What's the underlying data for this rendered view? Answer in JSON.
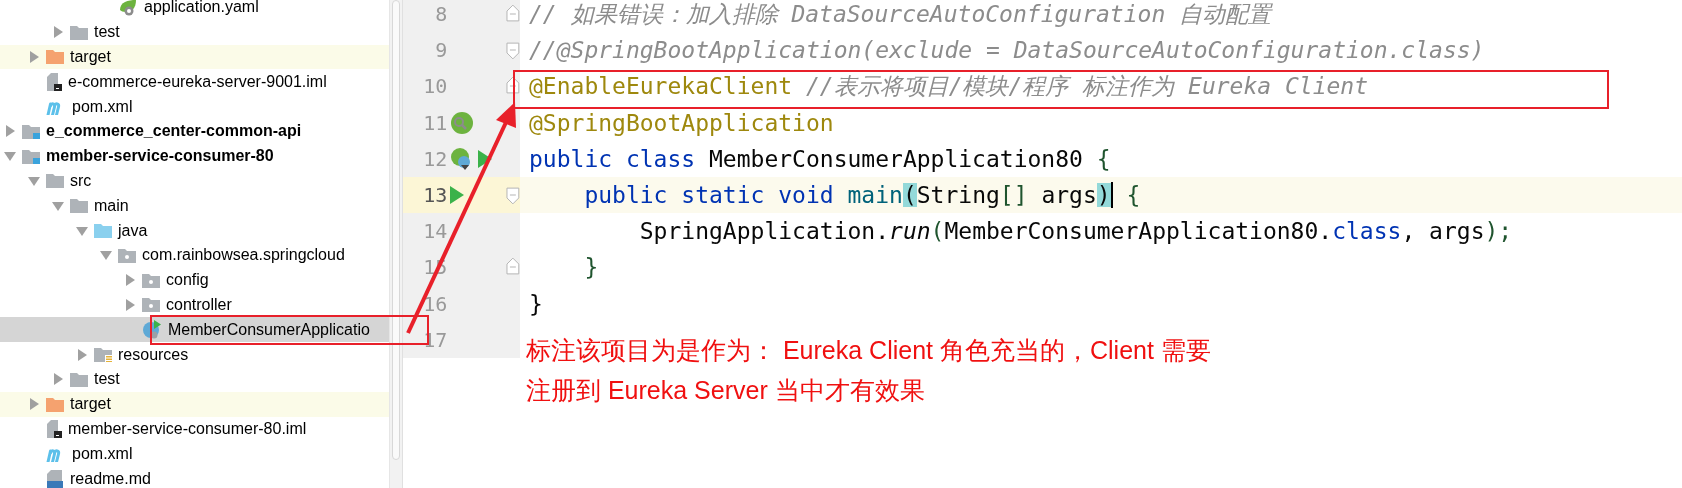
{
  "project_tree": {
    "items": [
      {
        "children": [
          {
            "children": [
              {
                "children": [
                  {
                    "children": [
                      {
                        "label": "application.yaml",
                        "kind": "yaml",
                        "selected": false
                      }
                    ]
                  }
                ]
              },
              {
                "label": "test",
                "kind": "folder",
                "expanded": false,
                "selected": false
              }
            ]
          },
          {
            "label": "target",
            "kind": "excluded-folder",
            "expanded": false,
            "selected": false
          },
          {
            "label": "e-commerce-eureka-server-9001.iml",
            "kind": "iml",
            "selected": false
          },
          {
            "label": "pom.xml",
            "kind": "pom",
            "selected": false
          }
        ]
      },
      {
        "label": "e_commerce_center-common-api",
        "kind": "module",
        "expanded": false,
        "selected": false
      },
      {
        "label": "member-service-consumer-80",
        "kind": "module",
        "expanded": true,
        "selected": false,
        "children": [
          {
            "label": "src",
            "kind": "folder",
            "expanded": true,
            "selected": false,
            "children": [
              {
                "label": "main",
                "kind": "folder",
                "expanded": true,
                "selected": false,
                "children": [
                  {
                    "label": "java",
                    "kind": "source-folder",
                    "expanded": true,
                    "selected": false,
                    "children": [
                      {
                        "label": "com.rainbowsea.springcloud",
                        "kind": "package",
                        "expanded": true,
                        "selected": false,
                        "children": [
                          {
                            "label": "config",
                            "kind": "package",
                            "expanded": false,
                            "selected": false
                          },
                          {
                            "label": "controller",
                            "kind": "package",
                            "expanded": false,
                            "selected": false
                          },
                          {
                            "label": "MemberConsumerApplicatio",
                            "kind": "class",
                            "selected": true
                          }
                        ]
                      }
                    ]
                  },
                  {
                    "label": "resources",
                    "kind": "resources",
                    "expanded": false,
                    "selected": false
                  }
                ]
              },
              {
                "label": "test",
                "kind": "folder",
                "expanded": false,
                "selected": false
              }
            ]
          },
          {
            "label": "target",
            "kind": "excluded-folder",
            "expanded": false,
            "selected": false
          },
          {
            "label": "member-service-consumer-80.iml",
            "kind": "iml",
            "selected": false
          },
          {
            "label": "pom.xml",
            "kind": "pom",
            "selected": false
          },
          {
            "label": "readme.md",
            "kind": "markdown",
            "selected": false
          }
        ]
      }
    ]
  },
  "editor": {
    "lines": [
      {
        "number": "8",
        "current": false,
        "fold": {
          "kind": "end"
        },
        "tokens": [
          {
            "text": "// 如果错误：加入排除 DataSourceAutoConfiguration 自动配置",
            "kind": "comment"
          }
        ]
      },
      {
        "number": "9",
        "current": false,
        "fold": {
          "kind": "start"
        },
        "tokens": [
          {
            "text": "//@SpringBootApplication(exclude = DataSourceAutoConfiguration.class)",
            "kind": "comment"
          }
        ]
      },
      {
        "number": "10",
        "current": false,
        "fold": {
          "kind": "end"
        },
        "tokens": [
          {
            "text": "@EnableEurekaClient ",
            "kind": "annotation"
          },
          {
            "text": "//表示将项目/模块/程序 标注作为 Eureka Client",
            "kind": "comment"
          }
        ]
      },
      {
        "number": "11",
        "current": false,
        "gutter": [
          {
            "kind": "bean-search"
          }
        ],
        "tokens": [
          {
            "text": "@SpringBootApplication",
            "kind": "annotation"
          }
        ]
      },
      {
        "number": "12",
        "current": false,
        "gutter": [
          {
            "kind": "bean"
          },
          {
            "kind": "run"
          }
        ],
        "tokens": [
          {
            "text": "public class ",
            "kind": "keyword"
          },
          {
            "text": "MemberConsumerApplication80 ",
            "kind": "plain"
          },
          {
            "text": "{",
            "kind": "brace"
          }
        ]
      },
      {
        "number": "13",
        "current": true,
        "fold": {
          "kind": "start"
        },
        "gutter": [
          {
            "kind": "run"
          }
        ],
        "tokens": [
          {
            "text": "    public static void ",
            "kind": "keyword"
          },
          {
            "text": "main",
            "kind": "method"
          },
          {
            "text": "(",
            "kind": "paren-match"
          },
          {
            "text": "String",
            "kind": "plain"
          },
          {
            "text": "[] ",
            "kind": "brace"
          },
          {
            "text": "args",
            "kind": "plain"
          },
          {
            "text": ")",
            "kind": "paren-match"
          },
          {
            "kind": "caret"
          },
          {
            "text": " {",
            "kind": "brace"
          }
        ]
      },
      {
        "number": "14",
        "current": false,
        "tokens": [
          {
            "text": "        SpringApplication.",
            "kind": "plain"
          },
          {
            "text": "run",
            "kind": "static-call"
          },
          {
            "text": "(",
            "kind": "brace"
          },
          {
            "text": "MemberConsumerApplication80.",
            "kind": "plain"
          },
          {
            "text": "class",
            "kind": "keyword"
          },
          {
            "text": ", args",
            "kind": "plain"
          },
          {
            "text": ");",
            "kind": "brace"
          }
        ]
      },
      {
        "number": "15",
        "current": false,
        "fold": {
          "kind": "end"
        },
        "tokens": [
          {
            "text": "    }",
            "kind": "brace"
          }
        ]
      },
      {
        "number": "16",
        "current": false,
        "tokens": [
          {
            "text": "}",
            "kind": "plain"
          }
        ]
      },
      {
        "number": "17",
        "current": false
      }
    ]
  },
  "annotation": {
    "lines": [
      "标注该项目为是作为： Eureka Client 角色充当的，Client 需要",
      "注册到 Eureka Server 当中才有效果"
    ]
  }
}
